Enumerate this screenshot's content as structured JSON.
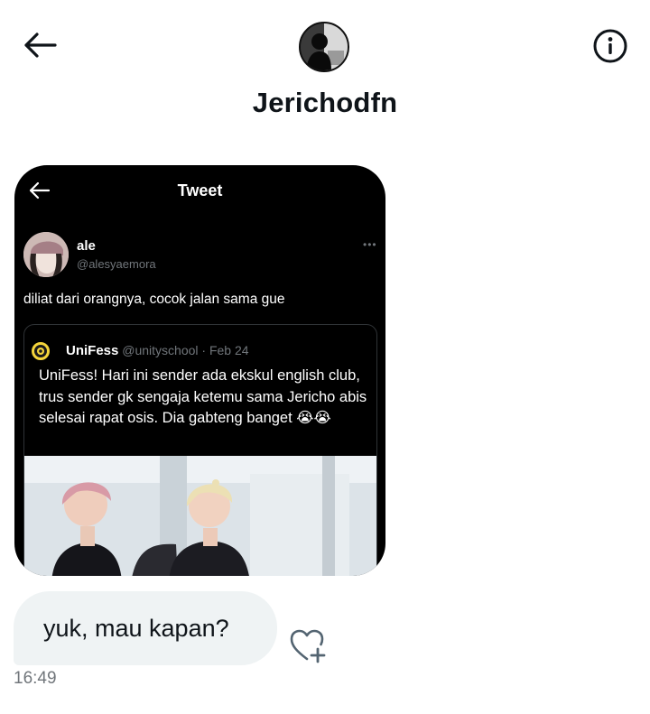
{
  "header": {
    "username": "Jerichodfn",
    "back_icon": "arrow-left-icon",
    "info_icon": "info-circle-icon"
  },
  "shared_tweet": {
    "screen_title": "Tweet",
    "author_name": "ale",
    "author_handle": "@alesyaemora",
    "more_icon": "more-dots-icon",
    "text": "diliat dari orangnya, cocok jalan sama gue",
    "quote": {
      "name": "UniFess",
      "handle": "@unityschool",
      "separator": "·",
      "date": "Feb 24",
      "text": "UniFess! Hari ini sender ada ekskul english club, trus sender gk sengaja ketemu sama Jericho abis selesai rapat osis. Dia gabteng banget 😭😭"
    }
  },
  "message": {
    "text": "yuk, mau kapan?",
    "timestamp": "16:49",
    "react_icon": "heart-plus-icon"
  },
  "colors": {
    "card_bg": "#000000",
    "bubble_bg": "#eff3f4",
    "muted": "#71767b",
    "text": "#0f1419"
  }
}
